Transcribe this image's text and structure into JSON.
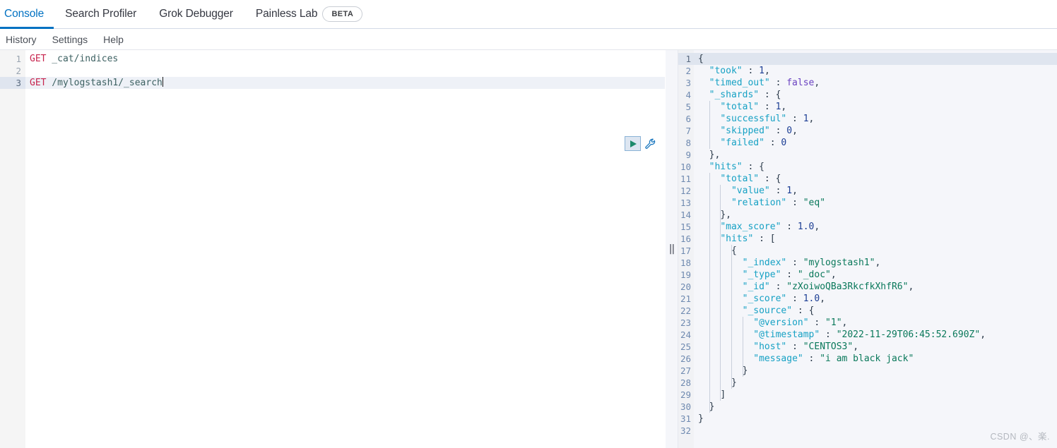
{
  "tabs": [
    {
      "label": "Console",
      "active": true,
      "badge": null
    },
    {
      "label": "Search Profiler",
      "active": false,
      "badge": null
    },
    {
      "label": "Grok Debugger",
      "active": false,
      "badge": null
    },
    {
      "label": "Painless Lab",
      "active": false,
      "badge": "BETA"
    }
  ],
  "submenu": [
    {
      "label": "History"
    },
    {
      "label": "Settings"
    },
    {
      "label": "Help"
    }
  ],
  "colors": {
    "accent": "#0071c2",
    "method": "#c7254e",
    "json_key": "#16a1c4",
    "json_string": "#09785a",
    "json_number": "#1c3e94",
    "json_boolean": "#6a42c1",
    "play_triangle": "#1d8a6b",
    "wrench": "#1f7ac0",
    "active_line": "#dfe5ef"
  },
  "request_editor": {
    "name": "console-request-editor",
    "active_line": 3,
    "lines": [
      {
        "n": 1,
        "method": "GET",
        "url": " _cat/indices",
        "caret": false
      },
      {
        "n": 2,
        "method": "",
        "url": "",
        "caret": false
      },
      {
        "n": 3,
        "method": "GET",
        "url": " /mylogstash1/_search",
        "caret": true
      }
    ]
  },
  "run_controls": {
    "play_label": "play-icon",
    "wrench_label": "wrench-icon"
  },
  "splitter": {
    "grip": "||"
  },
  "response_editor": {
    "name": "console-response-editor",
    "active_line": 1,
    "lines": [
      {
        "n": 1,
        "fold": "▾",
        "indent": 0,
        "text": "{"
      },
      {
        "n": 2,
        "fold": "",
        "indent": 0,
        "text": "  \"took\" : 1,"
      },
      {
        "n": 3,
        "fold": "",
        "indent": 0,
        "text": "  \"timed_out\" : false,"
      },
      {
        "n": 4,
        "fold": "▾",
        "indent": 0,
        "text": "  \"_shards\" : {"
      },
      {
        "n": 5,
        "fold": "",
        "indent": 0,
        "text": "    \"total\" : 1,"
      },
      {
        "n": 6,
        "fold": "",
        "indent": 0,
        "text": "    \"successful\" : 1,"
      },
      {
        "n": 7,
        "fold": "",
        "indent": 0,
        "text": "    \"skipped\" : 0,"
      },
      {
        "n": 8,
        "fold": "",
        "indent": 0,
        "text": "    \"failed\" : 0"
      },
      {
        "n": 9,
        "fold": "▴",
        "indent": 0,
        "text": "  },"
      },
      {
        "n": 10,
        "fold": "▾",
        "indent": 0,
        "text": "  \"hits\" : {"
      },
      {
        "n": 11,
        "fold": "▾",
        "indent": 0,
        "text": "    \"total\" : {"
      },
      {
        "n": 12,
        "fold": "",
        "indent": 0,
        "text": "      \"value\" : 1,"
      },
      {
        "n": 13,
        "fold": "",
        "indent": 0,
        "text": "      \"relation\" : \"eq\""
      },
      {
        "n": 14,
        "fold": "▴",
        "indent": 0,
        "text": "    },"
      },
      {
        "n": 15,
        "fold": "",
        "indent": 0,
        "text": "    \"max_score\" : 1.0,"
      },
      {
        "n": 16,
        "fold": "▾",
        "indent": 0,
        "text": "    \"hits\" : ["
      },
      {
        "n": 17,
        "fold": "▾",
        "indent": 0,
        "text": "      {"
      },
      {
        "n": 18,
        "fold": "",
        "indent": 0,
        "text": "        \"_index\" : \"mylogstash1\","
      },
      {
        "n": 19,
        "fold": "",
        "indent": 0,
        "text": "        \"_type\" : \"_doc\","
      },
      {
        "n": 20,
        "fold": "",
        "indent": 0,
        "text": "        \"_id\" : \"zXoiwoQBa3RkcfkXhfR6\","
      },
      {
        "n": 21,
        "fold": "",
        "indent": 0,
        "text": "        \"_score\" : 1.0,"
      },
      {
        "n": 22,
        "fold": "▾",
        "indent": 0,
        "text": "        \"_source\" : {"
      },
      {
        "n": 23,
        "fold": "",
        "indent": 0,
        "text": "          \"@version\" : \"1\","
      },
      {
        "n": 24,
        "fold": "",
        "indent": 0,
        "text": "          \"@timestamp\" : \"2022-11-29T06:45:52.690Z\","
      },
      {
        "n": 25,
        "fold": "",
        "indent": 0,
        "text": "          \"host\" : \"CENTOS3\","
      },
      {
        "n": 26,
        "fold": "",
        "indent": 0,
        "text": "          \"message\" : \"i am black jack\""
      },
      {
        "n": 27,
        "fold": "▴",
        "indent": 0,
        "text": "        }"
      },
      {
        "n": 28,
        "fold": "▴",
        "indent": 0,
        "text": "      }"
      },
      {
        "n": 29,
        "fold": "▴",
        "indent": 0,
        "text": "    ]"
      },
      {
        "n": 30,
        "fold": "▴",
        "indent": 0,
        "text": "  }"
      },
      {
        "n": 31,
        "fold": "▴",
        "indent": 0,
        "text": "}"
      },
      {
        "n": 32,
        "fold": "",
        "indent": 0,
        "text": ""
      }
    ]
  },
  "watermark": {
    "text": "CSDN @、楽."
  }
}
